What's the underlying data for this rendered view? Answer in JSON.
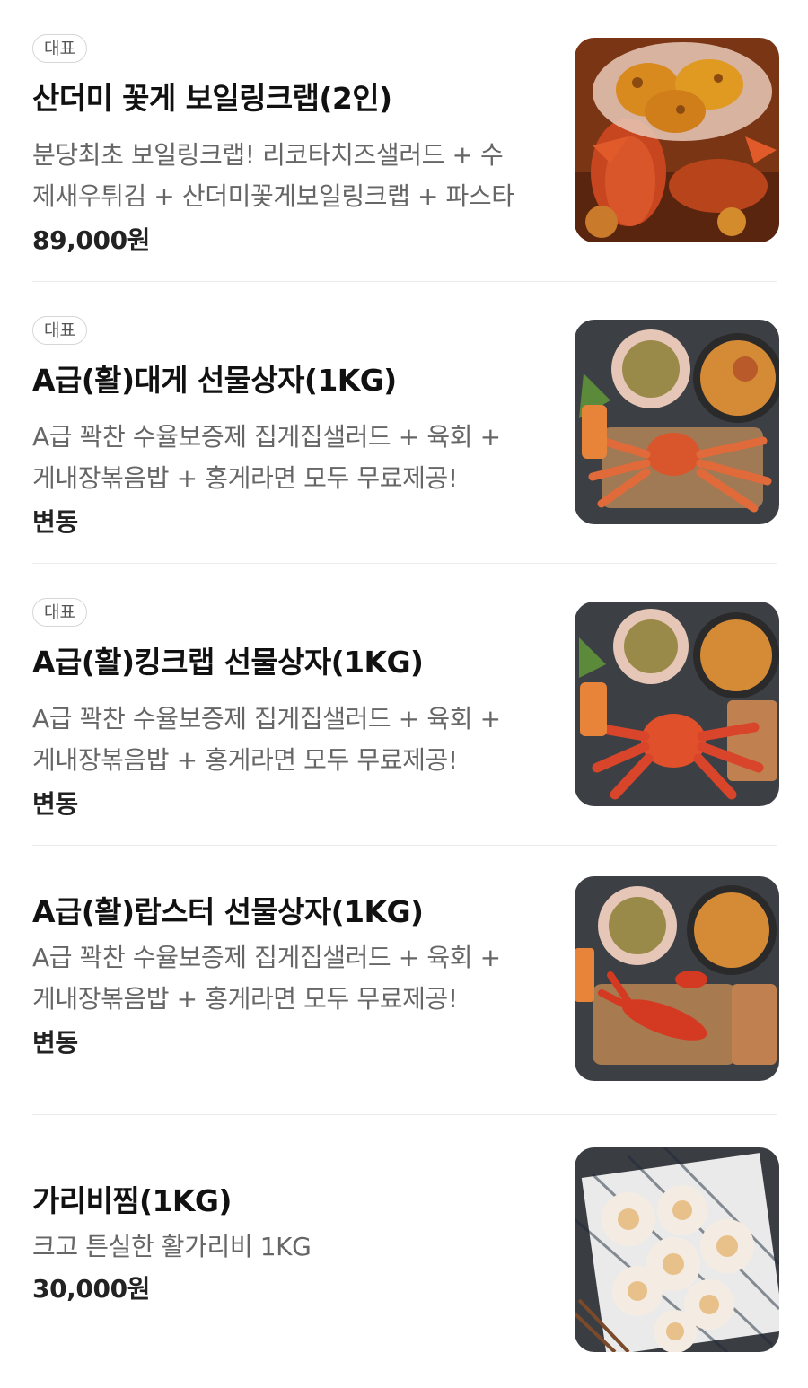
{
  "items": [
    {
      "badge": "대표",
      "name": "산더미 꽃게 보일링크랩(2인)",
      "desc_line1": "분당최초 보일링크랩! 리코타치즈샐러드 + 수",
      "desc_line2": "제새우튀김 + 산더미꽃게보일링크랩 + 파스타",
      "price": "89,000원",
      "image_icon": "boiling-crab-photo"
    },
    {
      "badge": "대표",
      "name": "A급(활)대게 선물상자(1KG)",
      "desc_line1": "A급 꽉찬 수율보증제 집게집샐러드 + 육회 +",
      "desc_line2": "게내장볶음밥 + 홍게라면 모두 무료제공!",
      "price": "변동",
      "image_icon": "snow-crab-platter-photo"
    },
    {
      "badge": "대표",
      "name": "A급(활)킹크랩 선물상자(1KG)",
      "desc_line1": "A급 꽉찬 수율보증제 집게집샐러드 + 육회 +",
      "desc_line2": "게내장볶음밥 + 홍게라면 모두 무료제공!",
      "price": "변동",
      "image_icon": "king-crab-platter-photo"
    },
    {
      "name": "A급(활)랍스터 선물상자(1KG)",
      "desc_line1": "A급 꽉찬 수율보증제 집게집샐러드 + 육회 +",
      "desc_line2": "게내장볶음밥 + 홍게라면 모두 무료제공!",
      "price": "변동",
      "image_icon": "lobster-platter-photo"
    },
    {
      "name": "가리비찜(1KG)",
      "desc_line1": "크고 튼실한 활가리비 1KG",
      "price": "30,000원",
      "image_icon": "steamed-scallops-photo"
    }
  ]
}
